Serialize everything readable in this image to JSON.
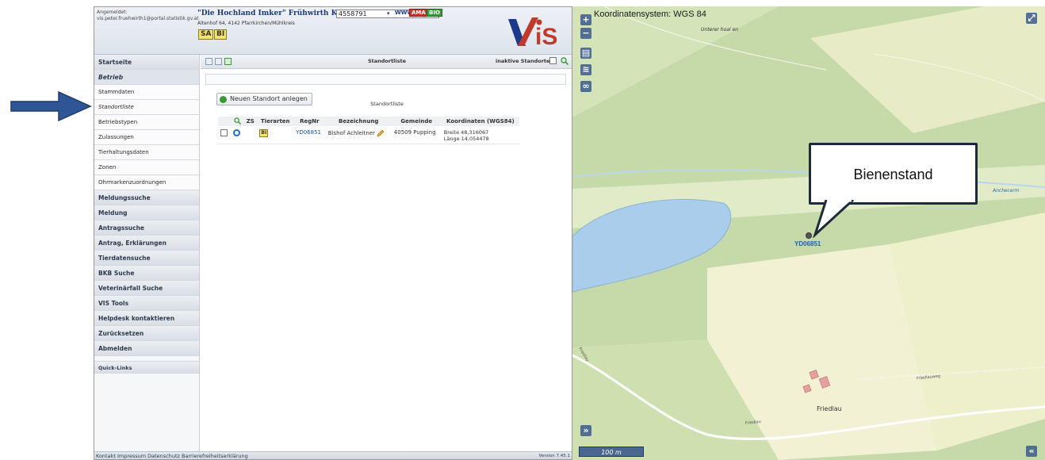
{
  "header": {
    "login_label": "Angemeldet:",
    "login_user": "vis.peter.fruehwirth1@portal.statistik.gv.at",
    "company_name": "\"Die Hochland Imker\" Frühwirth KG",
    "company_reg": "4558791",
    "badge_www": "WWW",
    "badge_ama": "AMA",
    "badge_bio": "BIO",
    "address": "Altenhof 64, 4142 Pfarrkirchen/Mühlkreis",
    "species_tags": [
      "SA",
      "BI"
    ],
    "logo_text": "VIS",
    "colors": {
      "header_bg": "#dde3ec",
      "logo_red": "#c0392b",
      "logo_blue": "#1b3a8a"
    }
  },
  "sidebar": {
    "items": [
      {
        "label": "Startseite",
        "kind": "main"
      },
      {
        "label": "Betrieb",
        "kind": "main-active"
      },
      {
        "label": "Stammdaten",
        "kind": "sub"
      },
      {
        "label": "Standortliste",
        "kind": "sub-active"
      },
      {
        "label": "Betriebstypen",
        "kind": "sub"
      },
      {
        "label": "Zulassungen",
        "kind": "sub"
      },
      {
        "label": "Tierhaltungsdaten",
        "kind": "sub"
      },
      {
        "label": "Zonen",
        "kind": "sub"
      },
      {
        "label": "Ohrmarkenzuordnungen",
        "kind": "sub"
      },
      {
        "label": "Meldungssuche",
        "kind": "main"
      },
      {
        "label": "Meldung",
        "kind": "main"
      },
      {
        "label": "Antragssuche",
        "kind": "main"
      },
      {
        "label": "Antrag, Erklärungen",
        "kind": "main"
      },
      {
        "label": "Tierdatensuche",
        "kind": "main"
      },
      {
        "label": "BKB Suche",
        "kind": "main"
      },
      {
        "label": "Veterinärfall Suche",
        "kind": "main"
      },
      {
        "label": "VIS Tools",
        "kind": "main"
      },
      {
        "label": "Helpdesk kontaktieren",
        "kind": "main"
      },
      {
        "label": "Zurücksetzen",
        "kind": "main"
      },
      {
        "label": "Abmelden",
        "kind": "main"
      }
    ],
    "quick_links": "Quick-Links"
  },
  "main": {
    "toolbar_title": "Standortliste",
    "inactive_label": "inaktive Standorte",
    "new_location_button": "Neuen Standort anlegen",
    "table_caption": "Standortliste",
    "table": {
      "headers": [
        "",
        "",
        "ZS",
        "Tierarten",
        "RegNr",
        "Bezeichnung",
        "Gemeinde",
        "Koordinaten (WGS84)"
      ],
      "rows": [
        {
          "species": "BI",
          "regnr": "YD06851",
          "name": "Bishof Achleitner",
          "municipality": "40509 Pupping",
          "lat": "Breite 48,316067",
          "lon": "Länge 14,054478"
        }
      ]
    }
  },
  "footer": {
    "links": "Kontakt Impressum Datenschutz Barrierefreiheitserklärung",
    "version": "Version 7.45.1"
  },
  "map": {
    "crs_label": "Koordinatensystem: WGS 84",
    "zoom_in": "+",
    "zoom_out": "−",
    "expand": "»",
    "place_unterer": "Unterer hoal en",
    "place_ancherarm": "Ancherarm",
    "place_friedlau": "Friedlau",
    "place_friedlau_road": "Friedlau",
    "place_friedlau_left": "Friedlau",
    "place_friedlauweg": "Friedlauweg",
    "marker_label": "YD06851",
    "callout_text": "Bienenstand",
    "scale": "100 m",
    "colors": {
      "field": "#f2f1d4",
      "forest": "#c6d9a8",
      "water": "#a9cdea",
      "road": "#ffffff"
    }
  },
  "annotation": {
    "arrow_color": "#2f5597"
  }
}
